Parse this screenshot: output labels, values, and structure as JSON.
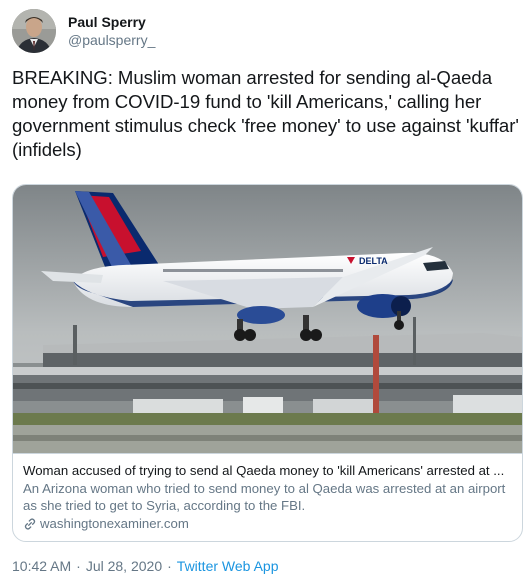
{
  "author": {
    "display_name": "Paul Sperry",
    "handle": "@paulsperry_"
  },
  "tweet": {
    "text": "BREAKING: Muslim woman arrested for sending al-Qaeda money from COVID-19 fund to 'kill Americans,' calling her government stimulus check 'free money' to use against 'kuffar' (infidels)"
  },
  "card": {
    "image_description_icon": "airplane-photo",
    "title": "Woman accused of trying to send al Qaeda money to 'kill Americans' arrested at ...",
    "description": "An Arizona woman who tried to send money to al Qaeda was arrested at an airport as she tried to get to Syria, according to the FBI.",
    "domain": "washingtonexaminer.com",
    "domain_icon": "link-icon",
    "aircraft_livery": "DELTA"
  },
  "footer": {
    "time": "10:42 AM",
    "separator": "·",
    "date": "Jul 28, 2020",
    "app": "Twitter Web App"
  },
  "colors": {
    "link": "#1b95e0",
    "secondary_text": "#657786",
    "border": "#ccd6dd",
    "delta_red": "#c8102e",
    "delta_blue": "#0a2a6e"
  }
}
